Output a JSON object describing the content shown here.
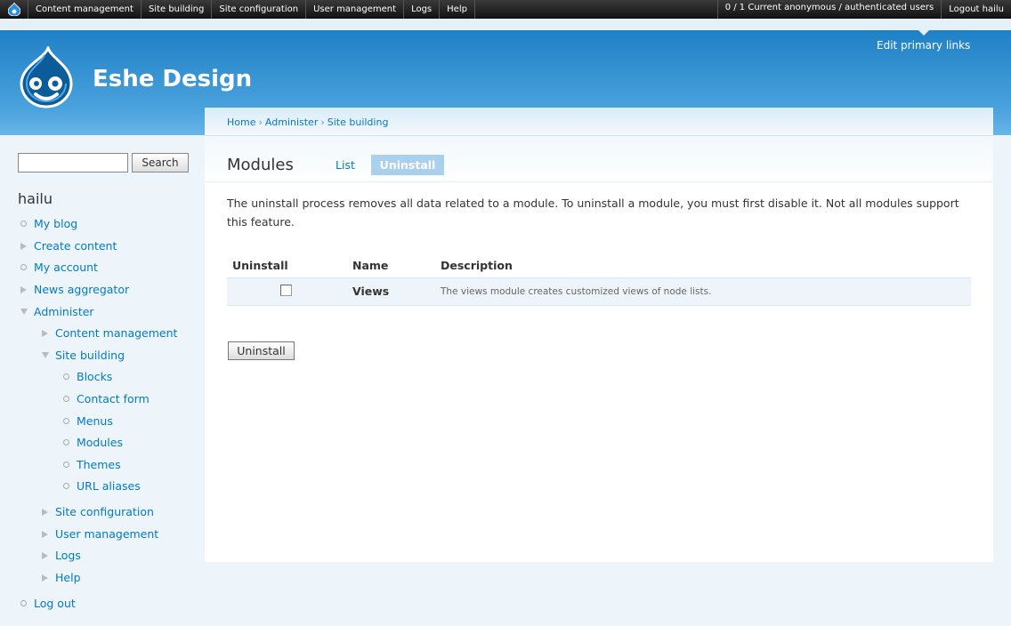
{
  "toolbar": {
    "items": [
      "Content management",
      "Site building",
      "Site configuration",
      "User management",
      "Logs",
      "Help"
    ],
    "users_text": "0 / 1 Current anonymous / authenticated users",
    "logout": "Logout hailu"
  },
  "header": {
    "site_name": "Eshe Design",
    "edit_primary_links": "Edit primary links"
  },
  "sidebar": {
    "search_button": "Search",
    "search_value": "",
    "user_name": "hailu",
    "menu": [
      {
        "label": "My blog",
        "type": "leaf"
      },
      {
        "label": "Create content",
        "type": "collapsed"
      },
      {
        "label": "My account",
        "type": "leaf"
      },
      {
        "label": "News aggregator",
        "type": "collapsed"
      },
      {
        "label": "Administer",
        "type": "expanded"
      },
      {
        "label": "Content management",
        "type": "collapsed"
      },
      {
        "label": "Site building",
        "type": "expanded"
      },
      {
        "label": "Blocks",
        "type": "leaf"
      },
      {
        "label": "Contact form",
        "type": "leaf"
      },
      {
        "label": "Menus",
        "type": "leaf"
      },
      {
        "label": "Modules",
        "type": "leaf"
      },
      {
        "label": "Themes",
        "type": "leaf"
      },
      {
        "label": "URL aliases",
        "type": "leaf"
      },
      {
        "label": "Site configuration",
        "type": "collapsed"
      },
      {
        "label": "User management",
        "type": "collapsed"
      },
      {
        "label": "Logs",
        "type": "collapsed"
      },
      {
        "label": "Help",
        "type": "collapsed"
      },
      {
        "label": "Log out",
        "type": "leaf"
      }
    ]
  },
  "breadcrumb": [
    "Home",
    "Administer",
    "Site building"
  ],
  "main": {
    "title": "Modules",
    "tabs": [
      {
        "label": "List",
        "active": false
      },
      {
        "label": "Uninstall",
        "active": true
      }
    ],
    "help": "The uninstall process removes all data related to a module. To uninstall a module, you must first disable it. Not all modules support this feature.",
    "table": {
      "headers": [
        "Uninstall",
        "Name",
        "Description"
      ],
      "rows": [
        {
          "checked": false,
          "name": "Views",
          "description": "The views module creates customized views of node lists."
        }
      ]
    },
    "submit_label": "Uninstall"
  },
  "colors": {
    "link": "#027ac6",
    "header_blue": "#1f80c5",
    "active_tab": "#a9d0ec"
  }
}
